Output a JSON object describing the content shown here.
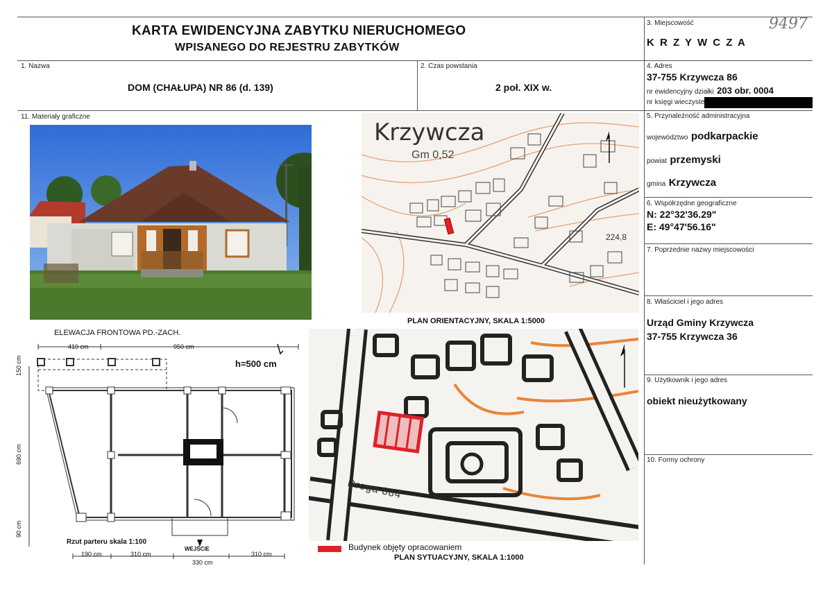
{
  "header": {
    "title_line1": "KARTA EWIDENCYJNA ZABYTKU NIERUCHOMEGO",
    "title_line2": "WPISANEGO DO REJESTRU ZABYTKÓW"
  },
  "handwritten_number": "9497",
  "fields": {
    "miejscowosc": {
      "label": "3. Miejscowość",
      "value": "K R Z Y W C Z A"
    },
    "nazwa": {
      "label": "1. Nazwa",
      "value": "DOM (CHAŁUPA) NR 86 (d. 139)"
    },
    "czas": {
      "label": "2. Czas powstania",
      "value": "2 poł. XIX w."
    },
    "adres": {
      "label": "4. Adres",
      "value": "37-755 Krzywcza 86",
      "dzialka_label": "nr ewidencyjny działki",
      "dzialka_value": "203 obr. 0004",
      "ksiega_label": "nr księgi wieczystej"
    },
    "materialy": {
      "label": "11. Materiały graficzne"
    },
    "przynaleznosc": {
      "label": "5. Przynależność administracyjna",
      "wojewodztwo_label": "województwo",
      "wojewodztwo_value": "podkarpackie",
      "powiat_label": "powiat",
      "powiat_value": "przemyski",
      "gmina_label": "gmina",
      "gmina_value": "Krzywcza"
    },
    "wspolrzedne": {
      "label": "6. Współrzędne geograficzne",
      "n": "N: 22°32'36.29\"",
      "e": "E: 49°47'56.16\""
    },
    "poprzednie": {
      "label": "7. Poprzednie nazwy miejscowości"
    },
    "wlasciciel": {
      "label": "8. Właściciel i jego adres",
      "line1": "Urząd Gminy Krzywcza",
      "line2": "37-755 Krzywcza 36"
    },
    "uzytkownik": {
      "label": "9. Użytkownik i jego adres",
      "value": "obiekt nieużytkowany"
    },
    "formy": {
      "label": "10. Formy ochrony"
    }
  },
  "map_orient": {
    "place": "Krzywcza",
    "gm": "Gm 0,52",
    "height": "224,8",
    "caption": "PLAN ORIENTACYJNY, SKALA 1:5000"
  },
  "map_sit": {
    "road": "Droga 884",
    "legend": "Budynek objęty opracowaniem",
    "caption": "PLAN SYTUACYJNY, SKALA 1:1000"
  },
  "plan": {
    "elev_caption": "ELEWACJA FRONTOWA PD.-ZACH.",
    "height": "h=500 cm",
    "dim_410": "410 cm",
    "dim_950": "950 cm",
    "dim_150": "150 cm",
    "dim_690": "690 cm",
    "dim_90": "90 cm",
    "dim_190": "190 cm",
    "dim_310a": "310 cm",
    "dim_330": "330 cm",
    "dim_310b": "310 cm",
    "rzut": "Rzut parteru skala 1:100",
    "wejscie": "WEJŚCIE"
  },
  "colors": {
    "red": "#e0202a",
    "orange": "#e8863a",
    "sky": "#3a74d0",
    "roof": "#6a3a2a"
  }
}
